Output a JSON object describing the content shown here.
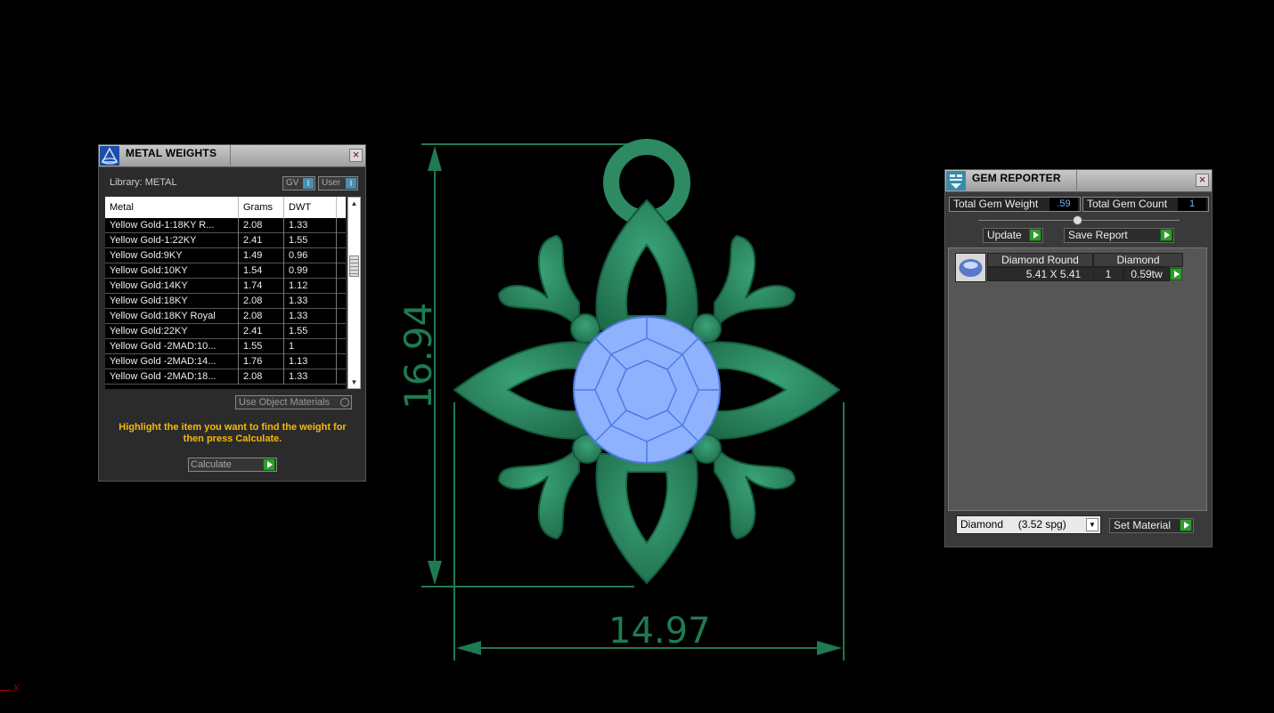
{
  "drawing": {
    "height_dimension": "16.94",
    "width_dimension": "14.97",
    "metal_color": "#2d8a63",
    "gem_color": "#8fb2ff",
    "dimension_color": "#1f7a52"
  },
  "axis_label": "X",
  "metal_panel": {
    "title": "METAL WEIGHTS",
    "library": "Library: METAL",
    "toggle_gv": "GV",
    "toggle_user": "User",
    "columns": [
      "Metal",
      "Grams",
      "DWT"
    ],
    "rows": [
      {
        "metal": "Yellow Gold-1:18KY R...",
        "grams": "2.08",
        "dwt": "1.33"
      },
      {
        "metal": "Yellow Gold-1:22KY",
        "grams": "2.41",
        "dwt": "1.55"
      },
      {
        "metal": "Yellow Gold:9KY",
        "grams": "1.49",
        "dwt": "0.96"
      },
      {
        "metal": "Yellow Gold:10KY",
        "grams": "1.54",
        "dwt": "0.99"
      },
      {
        "metal": "Yellow Gold:14KY",
        "grams": "1.74",
        "dwt": "1.12"
      },
      {
        "metal": "Yellow Gold:18KY",
        "grams": "2.08",
        "dwt": "1.33"
      },
      {
        "metal": "Yellow Gold:18KY Royal",
        "grams": "2.08",
        "dwt": "1.33"
      },
      {
        "metal": "Yellow Gold:22KY",
        "grams": "2.41",
        "dwt": "1.55"
      },
      {
        "metal": "Yellow Gold -2MAD:10...",
        "grams": "1.55",
        "dwt": "1"
      },
      {
        "metal": "Yellow Gold -2MAD:14...",
        "grams": "1.76",
        "dwt": "1.13"
      },
      {
        "metal": "Yellow Gold -2MAD:18...",
        "grams": "2.08",
        "dwt": "1.33"
      }
    ],
    "use_object_materials": "Use Object Materials",
    "hint": "Highlight the item you want to find the weight for then press Calculate.",
    "calculate": "Calculate"
  },
  "gem_panel": {
    "title": "GEM REPORTER",
    "total_weight_label": "Total Gem Weight",
    "total_weight_value": ".59",
    "total_count_label": "Total Gem Count",
    "total_count_value": "1",
    "update": "Update",
    "save_report": "Save Report",
    "gem": {
      "name": "Diamond Round",
      "material": "Diamond",
      "size": "5.41 X 5.41",
      "count": "1",
      "weight": "0.59tw"
    },
    "material_select": "Diamond     (3.52 spg)",
    "set_material": "Set Material"
  }
}
